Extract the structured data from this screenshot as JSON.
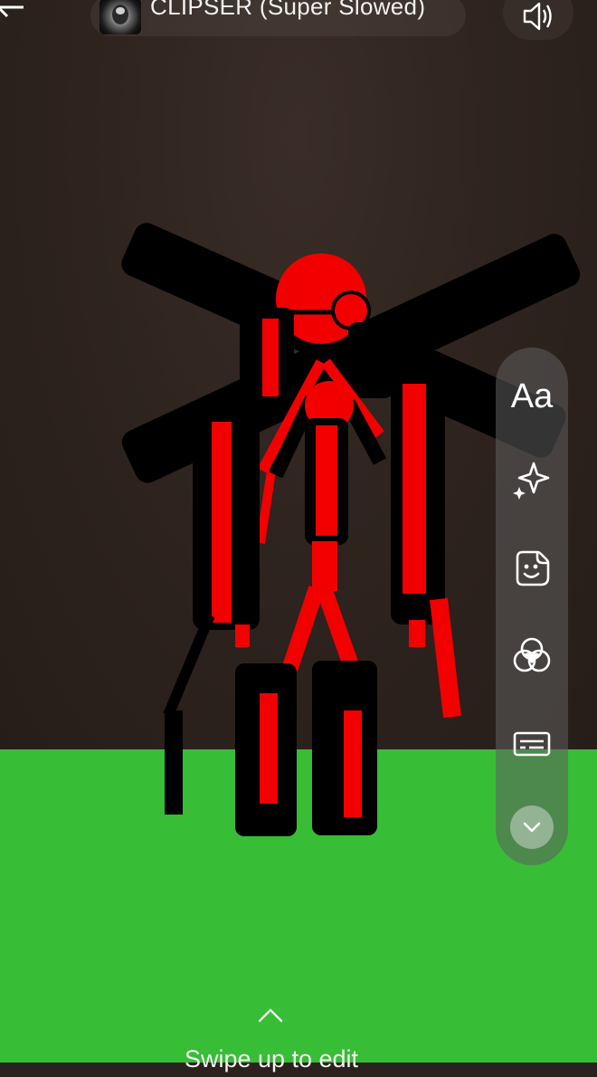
{
  "music": {
    "title": "CLIPSER (Super Slowed)",
    "thumbnail_icon": "album-art-icon"
  },
  "toolbar": {
    "text_label": "Aa",
    "tools": [
      {
        "name": "text",
        "icon": "text-icon"
      },
      {
        "name": "effects",
        "icon": "sparkle-icon"
      },
      {
        "name": "stickers",
        "icon": "sticker-icon"
      },
      {
        "name": "filters",
        "icon": "filters-icon"
      },
      {
        "name": "captions",
        "icon": "captions-icon"
      },
      {
        "name": "collapse",
        "icon": "chevron-down-icon"
      }
    ]
  },
  "hint": {
    "text": "Swipe up to edit"
  },
  "colors": {
    "wall": "#2c221d",
    "ground": "#38bd36",
    "figure_red": "#f20000",
    "figure_black": "#000000",
    "toolbar_bg": "#5f5f5f"
  }
}
